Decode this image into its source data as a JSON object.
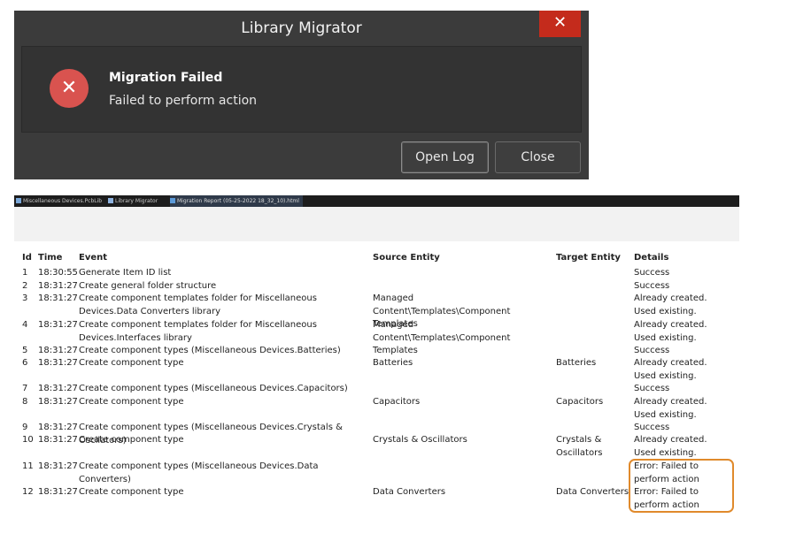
{
  "dialog": {
    "title": "Library Migrator",
    "close_glyph": "✕",
    "error_glyph": "✕",
    "message_title": "Migration Failed",
    "message_sub": "Failed to perform action",
    "open_log_label": "Open Log",
    "close_label": "Close"
  },
  "browser": {
    "tabs": [
      {
        "label": "Miscellaneous Devices.PcbLib",
        "icon": "document-icon"
      },
      {
        "label": "Library Migrator",
        "icon": "migrator-icon"
      },
      {
        "label": "Migration Report (05-25-2022 18_32_10).html",
        "icon": "report-icon"
      }
    ]
  },
  "report": {
    "columns": [
      "Id",
      "Time",
      "Event",
      "Source Entity",
      "Target Entity",
      "Details"
    ],
    "rows": [
      {
        "id": "1",
        "time": "18:30:55",
        "event": "Generate Item ID list",
        "source": "",
        "target": "",
        "details": "Success"
      },
      {
        "id": "2",
        "time": "18:31:27",
        "event": "Create general folder structure",
        "source": "",
        "target": "",
        "details": "Success"
      },
      {
        "id": "3",
        "time": "18:31:27",
        "event": "Create component templates folder for Miscellaneous Devices.Data Converters library",
        "source": "Managed Content\\Templates\\Component Templates",
        "target": "",
        "details": "Already created. Used existing."
      },
      {
        "id": "4",
        "time": "18:31:27",
        "event": "Create component templates folder for Miscellaneous Devices.Interfaces library",
        "source": "Managed Content\\Templates\\Component Templates",
        "target": "",
        "details": "Already created. Used existing."
      },
      {
        "id": "5",
        "time": "18:31:27",
        "event": "Create component types (Miscellaneous Devices.Batteries)",
        "source": "",
        "target": "",
        "details": "Success"
      },
      {
        "id": "6",
        "time": "18:31:27",
        "event": "Create component type",
        "source": "Batteries",
        "target": "Batteries",
        "details": "Already created. Used existing."
      },
      {
        "id": "7",
        "time": "18:31:27",
        "event": "Create component types (Miscellaneous Devices.Capacitors)",
        "source": "",
        "target": "",
        "details": "Success"
      },
      {
        "id": "8",
        "time": "18:31:27",
        "event": "Create component type",
        "source": "Capacitors",
        "target": "Capacitors",
        "details": "Already created. Used existing."
      },
      {
        "id": "9",
        "time": "18:31:27",
        "event": "Create component types (Miscellaneous Devices.Crystals & Oscilators)",
        "source": "",
        "target": "",
        "details": "Success"
      },
      {
        "id": "10",
        "time": "18:31:27",
        "event": "Create component type",
        "source": "Crystals & Oscillators",
        "target": "Crystals & Oscillators",
        "details": "Already created. Used existing."
      },
      {
        "id": "11",
        "time": "18:31:27",
        "event": "Create component types (Miscellaneous Devices.Data Converters)",
        "source": "",
        "target": "",
        "details": "Error: Failed to perform action"
      },
      {
        "id": "12",
        "time": "18:31:27",
        "event": "Create component type",
        "source": "Data Converters",
        "target": "Data Converters",
        "details": "Error: Failed to perform action"
      }
    ]
  }
}
